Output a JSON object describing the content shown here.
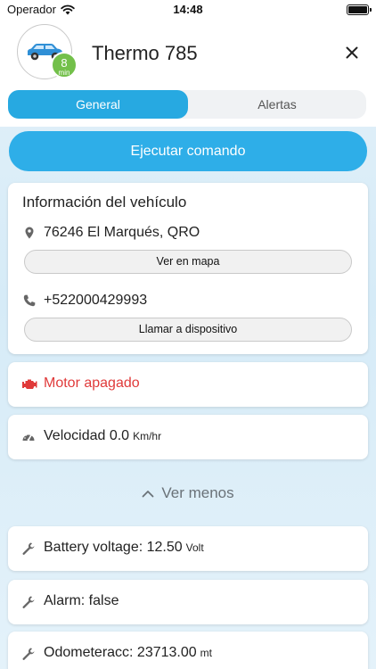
{
  "status_bar": {
    "carrier": "Operador",
    "time": "14:48"
  },
  "vehicle": {
    "name": "Thermo 785",
    "badge_value": "8",
    "badge_unit": "min"
  },
  "tabs": [
    {
      "label": "General",
      "active": true
    },
    {
      "label": "Alertas",
      "active": false
    }
  ],
  "execute_button": {
    "label": "Ejecutar comando"
  },
  "info_card": {
    "title": "Información del vehículo",
    "address": "76246 El Marqués, QRO",
    "map_button": "Ver en mapa",
    "phone": "+522000429993",
    "call_button": "Llamar a dispositivo"
  },
  "motor": {
    "status": "Motor apagado",
    "color": "#e03a3a"
  },
  "speed": {
    "label": "Velocidad 0.0",
    "unit": "Km/hr"
  },
  "toggle": {
    "label": "Ver menos"
  },
  "sensors": [
    {
      "label": "Battery voltage: 12.50",
      "unit": "Volt"
    },
    {
      "label": "Alarm: false",
      "unit": ""
    },
    {
      "label": "Odometeracc: 23713.00",
      "unit": "mt"
    }
  ],
  "colors": {
    "accent": "#27a9e1",
    "button": "#2eaee8",
    "badge": "#73c04a"
  }
}
